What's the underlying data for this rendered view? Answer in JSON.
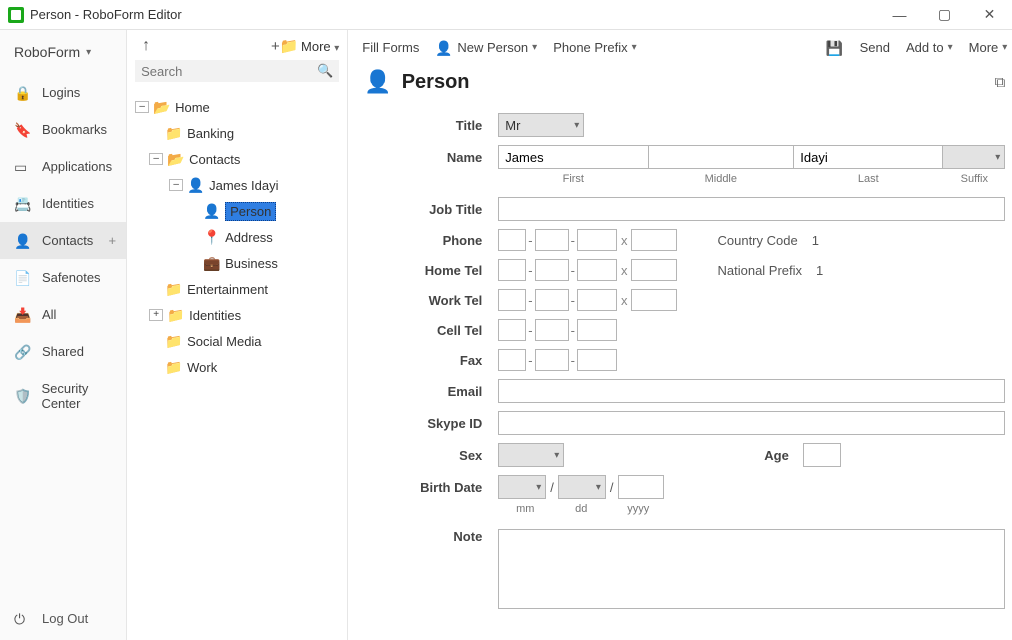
{
  "window": {
    "title": "Person - RoboForm Editor"
  },
  "appmenu": {
    "label": "RoboForm"
  },
  "sidebar": {
    "items": [
      {
        "label": "Logins",
        "icon": "lock"
      },
      {
        "label": "Bookmarks",
        "icon": "book"
      },
      {
        "label": "Applications",
        "icon": "app"
      },
      {
        "label": "Identities",
        "icon": "id"
      },
      {
        "label": "Contacts",
        "icon": "contact",
        "active": true,
        "plus": true
      },
      {
        "label": "Safenotes",
        "icon": "safe"
      },
      {
        "label": "All",
        "icon": "all"
      },
      {
        "label": "Shared",
        "icon": "share"
      },
      {
        "label": "Security Center",
        "icon": "shield"
      }
    ],
    "logout": "Log Out"
  },
  "treebar": {
    "more": "More"
  },
  "search": {
    "placeholder": "Search"
  },
  "tree": {
    "root": "Home",
    "items": [
      {
        "label": "Banking",
        "type": "folder",
        "depth": 1
      },
      {
        "label": "Contacts",
        "type": "folder",
        "depth": 1,
        "open": true
      },
      {
        "label": "James Idayi",
        "type": "folder",
        "depth": 2,
        "open": true,
        "icon": "contact"
      },
      {
        "label": "Person",
        "type": "leaf",
        "depth": 3,
        "icon": "person",
        "selected": true
      },
      {
        "label": "Address",
        "type": "leaf",
        "depth": 3,
        "icon": "pin"
      },
      {
        "label": "Business",
        "type": "leaf",
        "depth": 3,
        "icon": "brief"
      },
      {
        "label": "Entertainment",
        "type": "folder",
        "depth": 1
      },
      {
        "label": "Identities",
        "type": "folder",
        "depth": 1,
        "open": false,
        "toggle": "+"
      },
      {
        "label": "Social Media",
        "type": "folder",
        "depth": 1
      },
      {
        "label": "Work",
        "type": "folder",
        "depth": 1
      }
    ]
  },
  "toolbar": {
    "fillforms": "Fill Forms",
    "newperson": "New Person",
    "phoneprefix": "Phone Prefix",
    "send": "Send",
    "addto": "Add to",
    "more": "More"
  },
  "header": {
    "title": "Person"
  },
  "form": {
    "labels": {
      "title": "Title",
      "name": "Name",
      "jobtitle": "Job Title",
      "phone": "Phone",
      "hometel": "Home Tel",
      "worktel": "Work Tel",
      "celltel": "Cell Tel",
      "fax": "Fax",
      "email": "Email",
      "skype": "Skype ID",
      "sex": "Sex",
      "age": "Age",
      "birthdate": "Birth Date",
      "note": "Note",
      "first": "First",
      "middle": "Middle",
      "last": "Last",
      "suffix": "Suffix",
      "mm": "mm",
      "dd": "dd",
      "yyyy": "yyyy",
      "countrycode": "Country Code",
      "nationalprefix": "National Prefix"
    },
    "values": {
      "title": "Mr",
      "first": "James",
      "middle": "",
      "last": "Idayi",
      "suffix": "",
      "jobtitle": "",
      "email": "",
      "skype": "",
      "sex": "",
      "age": "",
      "countrycode": "1",
      "nationalprefix": "1"
    }
  }
}
